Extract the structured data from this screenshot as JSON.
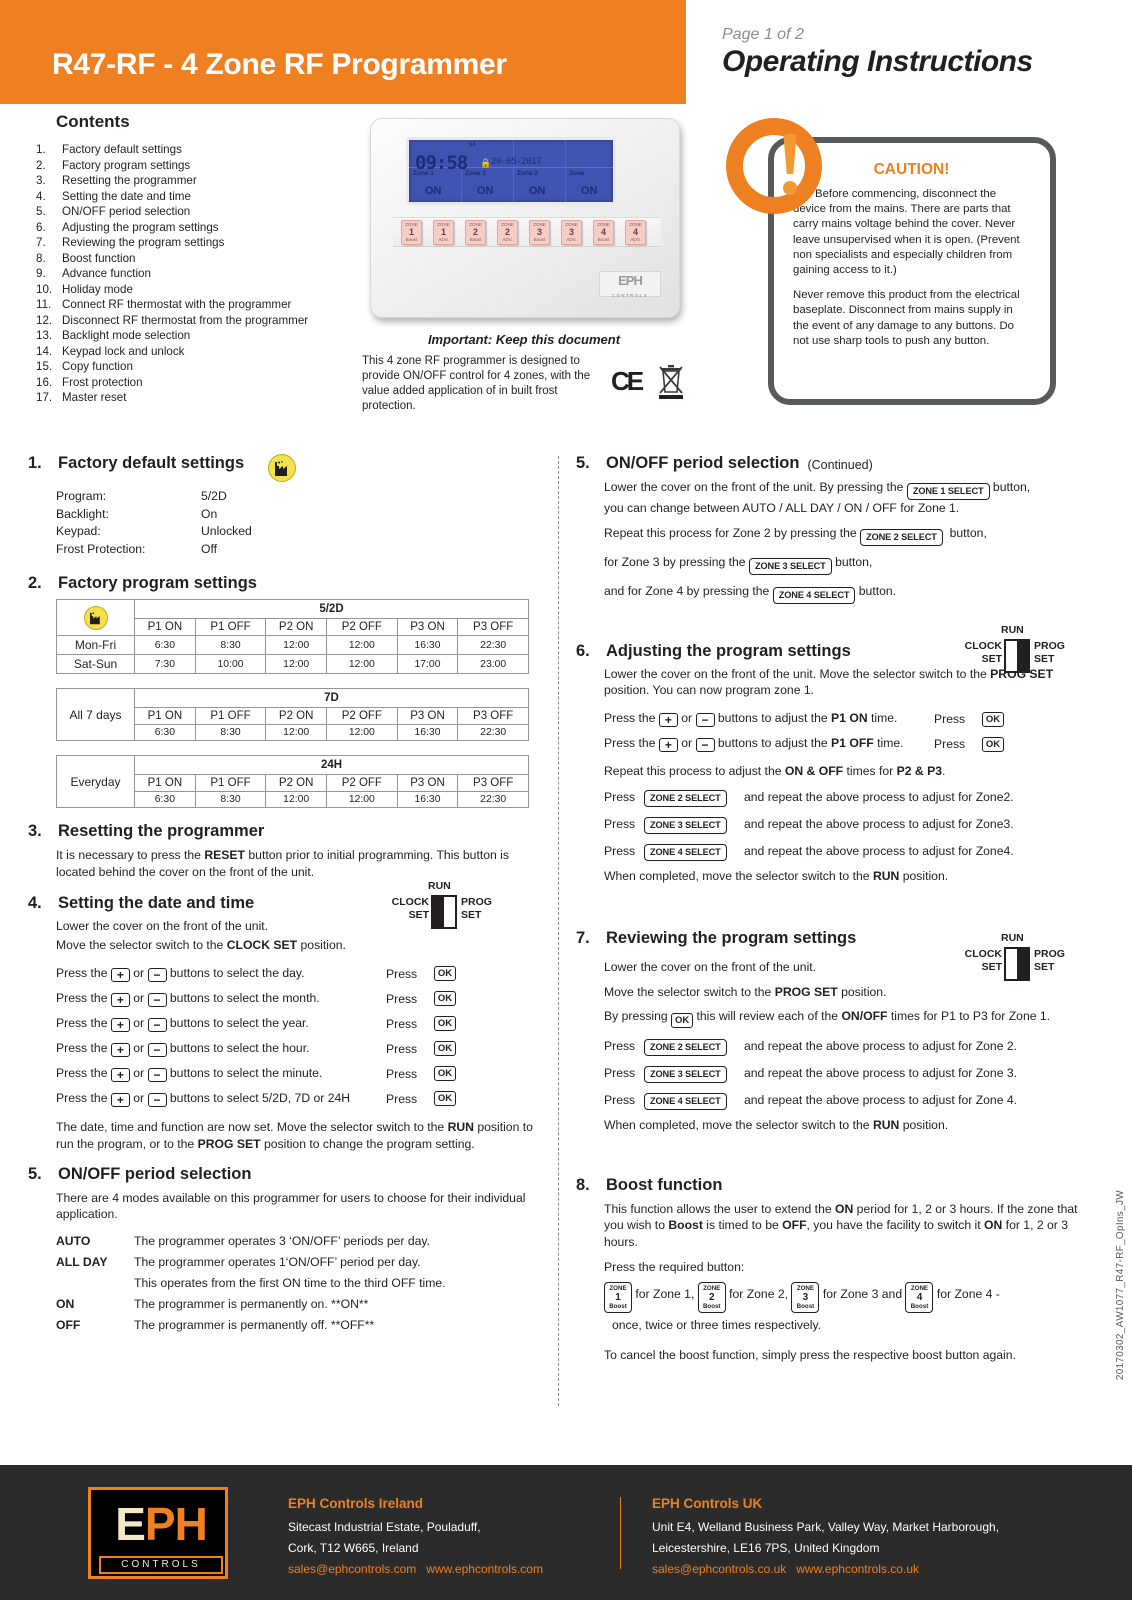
{
  "header": {
    "title": "R47-RF - 4 Zone RF Programmer",
    "page_of": "Page 1 of 2",
    "subtitle": "Operating Instructions"
  },
  "contents": {
    "title": "Contents",
    "items": [
      {
        "num": "1.",
        "label": "Factory default settings"
      },
      {
        "num": "2.",
        "label": "Factory program settings"
      },
      {
        "num": "3.",
        "label": "Resetting the programmer"
      },
      {
        "num": "4.",
        "label": "Setting the date and time"
      },
      {
        "num": "5.",
        "label": "ON/OFF period selection"
      },
      {
        "num": "6.",
        "label": "Adjusting the program settings"
      },
      {
        "num": "7.",
        "label": "Reviewing  the program settings"
      },
      {
        "num": "8.",
        "label": "Boost function"
      },
      {
        "num": "9.",
        "label": "Advance function"
      },
      {
        "num": "10.",
        "label": "Holiday mode"
      },
      {
        "num": "11.",
        "label": "Connect RF thermostat with the programmer"
      },
      {
        "num": "12.",
        "label": "Disconnect RF thermostat from the programmer"
      },
      {
        "num": "13.",
        "label": "Backlight mode selection"
      },
      {
        "num": "14.",
        "label": "Keypad lock and unlock"
      },
      {
        "num": "15.",
        "label": "Copy function"
      },
      {
        "num": "16.",
        "label": "Frost protection"
      },
      {
        "num": "17.",
        "label": "Master reset"
      }
    ]
  },
  "device": {
    "lcd_time": "09:58",
    "lcd_sa": "SA",
    "lcd_date": "20-05-2017",
    "zone_labels": [
      "Zone 1",
      "Zone 2",
      "Zone 3",
      "Zone"
    ],
    "zone_states": [
      "ON",
      "ON",
      "ON",
      "ON"
    ],
    "brand": "EPH",
    "brand_sub": "CONTROLS",
    "keys": [
      {
        "zone": "ZONE",
        "num": "1",
        "fn": "Boost"
      },
      {
        "zone": "ZONE",
        "num": "1",
        "fn": "ADV."
      },
      {
        "zone": "ZONE",
        "num": "2",
        "fn": "Boost"
      },
      {
        "zone": "ZONE",
        "num": "2",
        "fn": "ADV."
      },
      {
        "zone": "ZONE",
        "num": "3",
        "fn": "Boost"
      },
      {
        "zone": "ZONE",
        "num": "3",
        "fn": "ADV."
      },
      {
        "zone": "ZONE",
        "num": "4",
        "fn": "Boost"
      },
      {
        "zone": "ZONE",
        "num": "4",
        "fn": "ADV."
      }
    ],
    "important": "Important: Keep this document",
    "description": "This 4 zone RF programmer is designed to provide ON/OFF control for 4 zones, with the value added application of in built frost protection.",
    "ce_mark": "CE"
  },
  "caution": {
    "heading": "CAUTION!",
    "p1": "Before commencing, disconnect the device from the mains. There are parts that carry mains voltage behind the cover. Never leave unsupervised when it is open. (Prevent non specialists and especially children from gaining access to it.)",
    "p2": "Never remove this product from the electrical baseplate. Disconnect from mains supply in the event of any damage to any buttons. Do not use sharp tools to push any button."
  },
  "sec1": {
    "num": "1.",
    "title": "Factory default settings",
    "rows": [
      {
        "k": "Program:",
        "v": "5/2D"
      },
      {
        "k": "Backlight:",
        "v": "On"
      },
      {
        "k": "Keypad:",
        "v": "Unlocked"
      },
      {
        "k": "Frost Protection:",
        "v": "Off"
      }
    ]
  },
  "sec2": {
    "num": "2.",
    "title": "Factory program settings",
    "columns": [
      "P1 ON",
      "P1 OFF",
      "P2 ON",
      "P2 OFF",
      "P3 ON",
      "P3 OFF"
    ],
    "tables": [
      {
        "mode": "5/2D",
        "rows": [
          {
            "day": "Mon-Fri",
            "values": [
              "6:30",
              "8:30",
              "12:00",
              "12:00",
              "16:30",
              "22:30"
            ]
          },
          {
            "day": "Sat-Sun",
            "values": [
              "7:30",
              "10:00",
              "12:00",
              "12:00",
              "17:00",
              "23:00"
            ]
          }
        ]
      },
      {
        "mode": "7D",
        "rows": [
          {
            "day": "All 7 days",
            "values": [
              "6:30",
              "8:30",
              "12:00",
              "12:00",
              "16:30",
              "22:30"
            ]
          }
        ]
      },
      {
        "mode": "24H",
        "rows": [
          {
            "day": "Everyday",
            "values": [
              "6:30",
              "8:30",
              "12:00",
              "12:00",
              "16:30",
              "22:30"
            ]
          }
        ]
      }
    ]
  },
  "sec3": {
    "num": "3.",
    "title": "Resetting the programmer",
    "body_a": "It is necessary to press the ",
    "body_b": "RESET",
    "body_c": " button prior to initial programming. This button is located behind the cover on the front of the unit."
  },
  "sec4": {
    "num": "4.",
    "title": "Setting the date and time",
    "switch": {
      "run": "RUN",
      "clock": "CLOCK SET",
      "prog": "PROG SET",
      "position": "CLOCK SET"
    },
    "intro1": "Lower the cover on the front of the unit.",
    "intro2_a": "Move the selector switch to the ",
    "intro2_b": "CLOCK SET",
    "intro2_c": " position.",
    "press_word": "Press the",
    "or_word": "or",
    "press_label": "Press",
    "ok_label": "OK",
    "plus": "+",
    "minus": "−",
    "steps": [
      "buttons to select the day.",
      "buttons to select the month.",
      "buttons to select the year.",
      "buttons to select the hour.",
      "buttons to select the minute.",
      "buttons to select 5/2D, 7D or 24H"
    ],
    "closing_a": "The date, time and function are now set. Move the selector switch to the ",
    "closing_b": "RUN",
    "closing_c": " position to run the program, or to the ",
    "closing_d": "PROG SET",
    "closing_e": " position to change the program setting."
  },
  "sec5": {
    "num": "5.",
    "title": "ON/OFF period selection",
    "intro": "There are 4 modes available on this programmer for users to choose for their individual application.",
    "modes": [
      {
        "k": "AUTO",
        "v": "The programmer operates 3 ‘ON/OFF’ periods per day."
      },
      {
        "k": "ALL DAY",
        "v": "The programmer operates 1‘ON/OFF’ period per day."
      },
      {
        "k": "",
        "v": "This operates from the first ON time to the third OFF time."
      },
      {
        "k": "ON",
        "v": "The programmer is permanently on. **ON**"
      },
      {
        "k": "OFF",
        "v": "The programmer is permanently off. **OFF**"
      }
    ]
  },
  "sec5c": {
    "num": "5.",
    "title": "ON/OFF period selection",
    "continued": "(Continued)",
    "line1_a": "Lower the cover on the front of the unit. By pressing the",
    "zone1_key": "ZONE 1 SELECT",
    "line1_b": "button,",
    "line1_c": "you can change between AUTO / ALL DAY / ON / OFF for Zone 1.",
    "line2_a": "Repeat this process for Zone 2 by pressing the",
    "zone2_key": "ZONE 2 SELECT",
    "line2_b": "button,",
    "line3_a": "for Zone 3 by pressing the",
    "zone3_key": "ZONE 3 SELECT",
    "line3_b": "button,",
    "line4_a": "and for Zone 4 by pressing the",
    "zone4_key": "ZONE 4 SELECT",
    "line4_b": "button."
  },
  "sec6": {
    "num": "6.",
    "title": "Adjusting the program settings",
    "switch": {
      "run": "RUN",
      "clock": "CLOCK SET",
      "prog": "PROG SET",
      "position": "PROG SET"
    },
    "intro_a": "Lower the cover on the front of the unit. Move the selector switch to the ",
    "intro_b": "PROG SET",
    "intro_c": " position. You can now program zone 1.",
    "press_word": "Press the",
    "or_word": "or",
    "press_label": "Press",
    "ok_label": "OK",
    "plus": "+",
    "minus": "−",
    "step1_a": "buttons to adjust the ",
    "step1_b": "P1 ON",
    "step1_c": " time.",
    "step2_b": "P1 OFF",
    "repeat_a": "Repeat this process to adjust the ",
    "repeat_b": "ON & OFF",
    "repeat_c": " times for ",
    "repeat_d": "P2 & P3",
    "repeat_e": ".",
    "zone_rows": [
      {
        "lead": "Press",
        "key": "ZONE 2 SELECT",
        "tail": "and repeat the above process to adjust for Zone2."
      },
      {
        "lead": "Press",
        "key": "ZONE 3 SELECT",
        "tail": "and repeat the above process to adjust for Zone3."
      },
      {
        "lead": "Press",
        "key": "ZONE 4 SELECT",
        "tail": "and repeat the above process to adjust for Zone4."
      }
    ],
    "closing_a": "When completed, move the selector switch to the ",
    "closing_b": "RUN",
    "closing_c": " position."
  },
  "sec7": {
    "num": "7.",
    "title": "Reviewing the program settings",
    "switch": {
      "run": "RUN",
      "clock": "CLOCK SET",
      "prog": "PROG SET",
      "position": "PROG SET"
    },
    "line1": "Lower the cover on the front of the unit.",
    "line2_a": "Move the selector switch to the ",
    "line2_b": "PROG SET",
    "line2_c": " position.",
    "line3_a": "By pressing",
    "ok_label": "OK",
    "line3_b": "this will review each of the ",
    "line3_c": "ON/OFF",
    "line3_d": " times for P1 to P3 for Zone 1.",
    "zone_rows": [
      {
        "lead": "Press",
        "key": "ZONE 2 SELECT",
        "tail": "and repeat the above process to adjust  for Zone 2."
      },
      {
        "lead": "Press",
        "key": "ZONE 3 SELECT",
        "tail": "and repeat the above process to adjust  for Zone 3."
      },
      {
        "lead": "Press",
        "key": "ZONE 4 SELECT",
        "tail": "and repeat the above process to adjust  for Zone 4."
      }
    ],
    "closing_a": "When completed, move the selector switch to the ",
    "closing_b": "RUN",
    "closing_c": " position."
  },
  "sec8": {
    "num": "8.",
    "title": "Boost function",
    "p1_a": "This function allows the user to extend the ",
    "p1_b": "ON",
    "p1_c": " period for 1, 2 or 3 hours. If the zone that you wish to ",
    "p1_d": "Boost",
    "p1_e": " is timed to be ",
    "p1_f": "OFF",
    "p1_g": ", you have the facility to switch it ",
    "p1_h": "ON",
    "p1_i": " for 1, 2 or 3 hours.",
    "press_req": "Press the required button:",
    "buttons": [
      {
        "zone": "ZONE",
        "num": "1",
        "fn": "Boost",
        "after": "for Zone 1,"
      },
      {
        "zone": "ZONE",
        "num": "2",
        "fn": "Boost",
        "after": "for Zone 2,"
      },
      {
        "zone": "ZONE",
        "num": "3",
        "fn": "Boost",
        "after": "for Zone 3 and"
      },
      {
        "zone": "ZONE",
        "num": "4",
        "fn": "Boost",
        "after": "for Zone 4 -"
      }
    ],
    "times": "once, twice or three times respectively.",
    "cancel": "To cancel the boost function, simply press the respective boost button again."
  },
  "side_code": "20170302_AW1077_R47-RF_OpIns_JW",
  "footer": {
    "logo_e": "E",
    "logo_p": "P",
    "logo_h": "H",
    "logo_sub": "CONTROLS",
    "ireland": {
      "heading": "EPH Controls Ireland",
      "line1": "Sitecast Industrial Estate, Pouladuff,",
      "line2": "Cork, T12 W665, Ireland",
      "email": "sales@ephcontrols.com",
      "web": "www.ephcontrols.com"
    },
    "uk": {
      "heading": "EPH Controls UK",
      "line1": "Unit E4, Welland Business Park, Valley Way, Market Harborough,",
      "line2": "Leicestershire, LE16 7PS, United Kingdom",
      "email": "sales@ephcontrols.co.uk",
      "web": "www.ephcontrols.co.uk"
    }
  },
  "colors": {
    "brand_orange": "#ef8022",
    "dark": "#231f20",
    "footer_bg": "#2b2b2b",
    "lcd_blue": "#3f54b0",
    "factory_yellow": "#f4e04a"
  }
}
